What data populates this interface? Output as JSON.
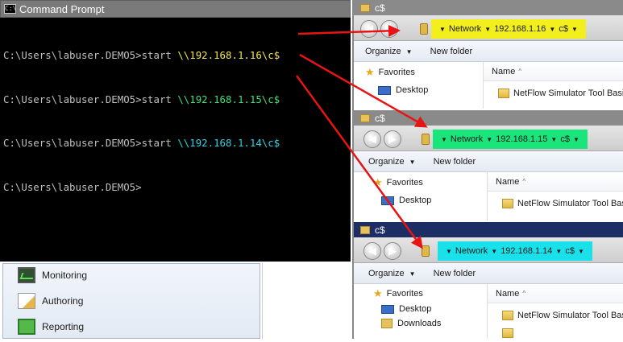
{
  "cmd": {
    "title": "Command Prompt",
    "icon_label": "C:\\",
    "lines": [
      {
        "prompt": "C:\\Users\\labuser.DEMO5>start ",
        "path": "\\\\192.168.1.16\\c$",
        "color": "#f3e84a"
      },
      {
        "prompt": "C:\\Users\\labuser.DEMO5>start ",
        "path": "\\\\192.168.1.15\\c$",
        "color": "#3fe07a"
      },
      {
        "prompt": "C:\\Users\\labuser.DEMO5>start ",
        "path": "\\\\192.168.1.14\\c$",
        "color": "#2fd3e6"
      },
      {
        "prompt": "C:\\Users\\labuser.DEMO5>",
        "path": "",
        "color": "#c0c0c0"
      }
    ]
  },
  "nav": {
    "items": [
      {
        "label": "Monitoring",
        "icon": "monitoring-icon"
      },
      {
        "label": "Authoring",
        "icon": "authoring-icon"
      },
      {
        "label": "Reporting",
        "icon": "reporting-icon"
      }
    ]
  },
  "windows": [
    {
      "title": "c$",
      "crumbs": [
        "Network",
        "192.168.1.16",
        "c$"
      ],
      "highlight": "#f2ef1c",
      "organize": "Organize",
      "new_folder": "New folder",
      "favorites": "Favorites",
      "desktop": "Desktop",
      "col_name": "Name",
      "file": "NetFlow Simulator Tool Basic"
    },
    {
      "title": "c$",
      "crumbs": [
        "Network",
        "192.168.1.15",
        "c$"
      ],
      "highlight": "#19e57a",
      "organize": "Organize",
      "new_folder": "New folder",
      "favorites": "Favorites",
      "desktop": "Desktop",
      "col_name": "Name",
      "file": "NetFlow Simulator Tool Basic"
    },
    {
      "title": "c$",
      "crumbs": [
        "Network",
        "192.168.1.14",
        "c$"
      ],
      "highlight": "#1ae0ea",
      "organize": "Organize",
      "new_folder": "New folder",
      "favorites": "Favorites",
      "desktop": "Desktop",
      "downloads": "Downloads",
      "col_name": "Name",
      "file": "NetFlow Simulator Tool Basic"
    }
  ],
  "colors": {
    "arrow": "#e61414",
    "cmd_background": "#000000",
    "cmd_text": "#c0c0c0"
  }
}
